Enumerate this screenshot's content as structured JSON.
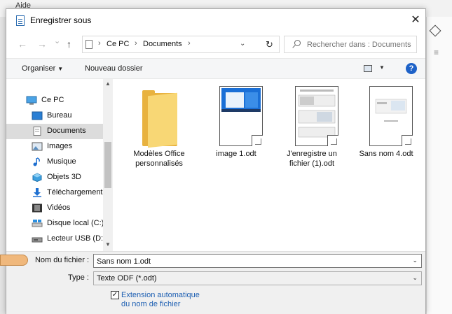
{
  "background": {
    "menu_label": "Aide"
  },
  "dialog": {
    "title": "Enregistrer sous",
    "close_symbol": "✕"
  },
  "address": {
    "back": "←",
    "forward": "→",
    "recent": "⌄",
    "up": "↑",
    "crumbs": [
      "Ce PC",
      "Documents"
    ],
    "separator": "›",
    "dropdown": "⌄",
    "refresh": "↻"
  },
  "search": {
    "placeholder": "Rechercher dans : Documents"
  },
  "toolbar": {
    "organize": "Organiser",
    "new_folder": "Nouveau dossier",
    "help": "?"
  },
  "nav": {
    "items": [
      {
        "label": "Ce PC",
        "icon": "monitor-icon"
      },
      {
        "label": "Bureau",
        "icon": "desktop-icon"
      },
      {
        "label": "Documents",
        "icon": "documents-icon",
        "selected": true
      },
      {
        "label": "Images",
        "icon": "images-icon"
      },
      {
        "label": "Musique",
        "icon": "music-icon"
      },
      {
        "label": "Objets 3D",
        "icon": "cube-icon"
      },
      {
        "label": "Téléchargements",
        "icon": "download-icon"
      },
      {
        "label": "Vidéos",
        "icon": "video-icon"
      },
      {
        "label": "Disque local (C:)",
        "icon": "disk-icon"
      },
      {
        "label": "Lecteur USB (D:)",
        "icon": "usb-drive-icon"
      }
    ]
  },
  "files": [
    {
      "label": "Modèles Office personnalisés",
      "kind": "folder"
    },
    {
      "label": "image 1.odt",
      "kind": "doc-image"
    },
    {
      "label": "J'enregistre un fichier (1).odt",
      "kind": "doc-screens"
    },
    {
      "label": "Sans nom 4.odt",
      "kind": "doc-sparse"
    }
  ],
  "filename": {
    "label": "Nom du fichier :",
    "value": "Sans nom 1.odt"
  },
  "filetype": {
    "label": "Type :",
    "value": "Texte ODF (*.odt)"
  },
  "auto_extension": {
    "label": "Extension automatique du nom de fichier",
    "checked": true,
    "mark": "✓"
  },
  "colors": {
    "accent": "#1e62c8",
    "folder": "#e8b23f",
    "link": "#1d5fb2",
    "pointer": "#f0b87c"
  }
}
